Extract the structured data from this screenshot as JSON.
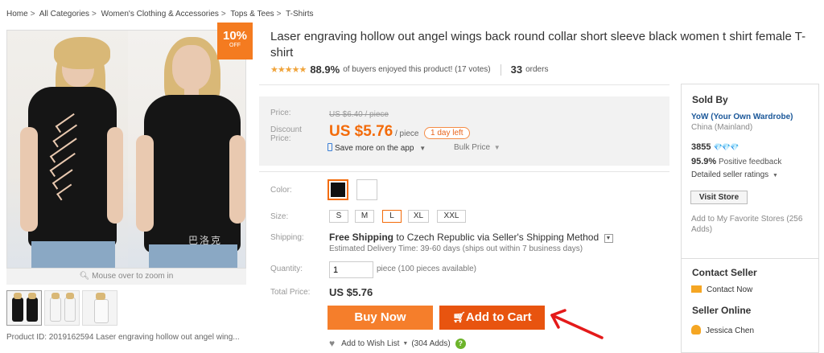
{
  "breadcrumb": [
    "Home",
    "All Categories",
    "Women's Clothing & Accessories",
    "Tops & Tees",
    "T-Shirts"
  ],
  "badge": {
    "value": "10%",
    "text": "OFF"
  },
  "image": {
    "watermark": "巴洛克",
    "zoom_hint": "Mouse over to zoom in"
  },
  "product_id_line": "Product ID: 2019162594 Laser engraving hollow out angel wing...",
  "title": "Laser engraving hollow out angel wings back round collar short sleeve black women t shirt female T-shirt",
  "rating": {
    "stars": "★★★★★",
    "percent": "88.9%",
    "text": "of buyers enjoyed this product! (17 votes)",
    "orders": "33",
    "orders_label": "orders"
  },
  "price": {
    "price_label": "Price:",
    "old_price": "US $6.40 / piece",
    "discount_label": "Discount Price:",
    "new_price": "US $5.76",
    "per_piece": "/ piece",
    "day_left": "1 day left",
    "save_app": "Save more on the app",
    "bulk": "Bulk Price"
  },
  "options": {
    "color_label": "Color:",
    "size_label": "Size:",
    "sizes": [
      "S",
      "M",
      "L",
      "XL",
      "XXL"
    ],
    "selected_size": "L",
    "shipping_label": "Shipping:",
    "shipping_free": "Free Shipping",
    "shipping_to": "to",
    "shipping_country": "Czech Republic",
    "shipping_via": "via Seller's Shipping Method",
    "delivery": "Estimated Delivery Time: 39-60 days (ships out within 7 business days)",
    "quantity_label": "Quantity:",
    "quantity_value": "1",
    "quantity_info": "piece (100 pieces available)",
    "total_label": "Total Price:",
    "total_value": "US $5.76"
  },
  "buttons": {
    "buy_now": "Buy Now",
    "add_to_cart": "Add to Cart"
  },
  "wish": {
    "label": "Add to Wish List",
    "count": "(304 Adds)"
  },
  "seller": {
    "heading": "Sold By",
    "name": "YoW (Your Own Wardrobe)",
    "location": "China (Mainland)",
    "score": "3855",
    "feedback_pct": "95.9%",
    "feedback_label": "Positive feedback",
    "detailed": "Detailed seller ratings",
    "visit": "Visit Store",
    "fav": "Add to My Favorite Stores (256 Adds)"
  },
  "contact": {
    "heading": "Contact Seller",
    "contact_now": "Contact Now",
    "online_heading": "Seller Online",
    "online_name": "Jessica Chen"
  },
  "colors": {
    "accent": "#f36b0a",
    "buy_now": "#f57e2b",
    "add_cart": "#e8540f",
    "link": "#1a5799"
  }
}
